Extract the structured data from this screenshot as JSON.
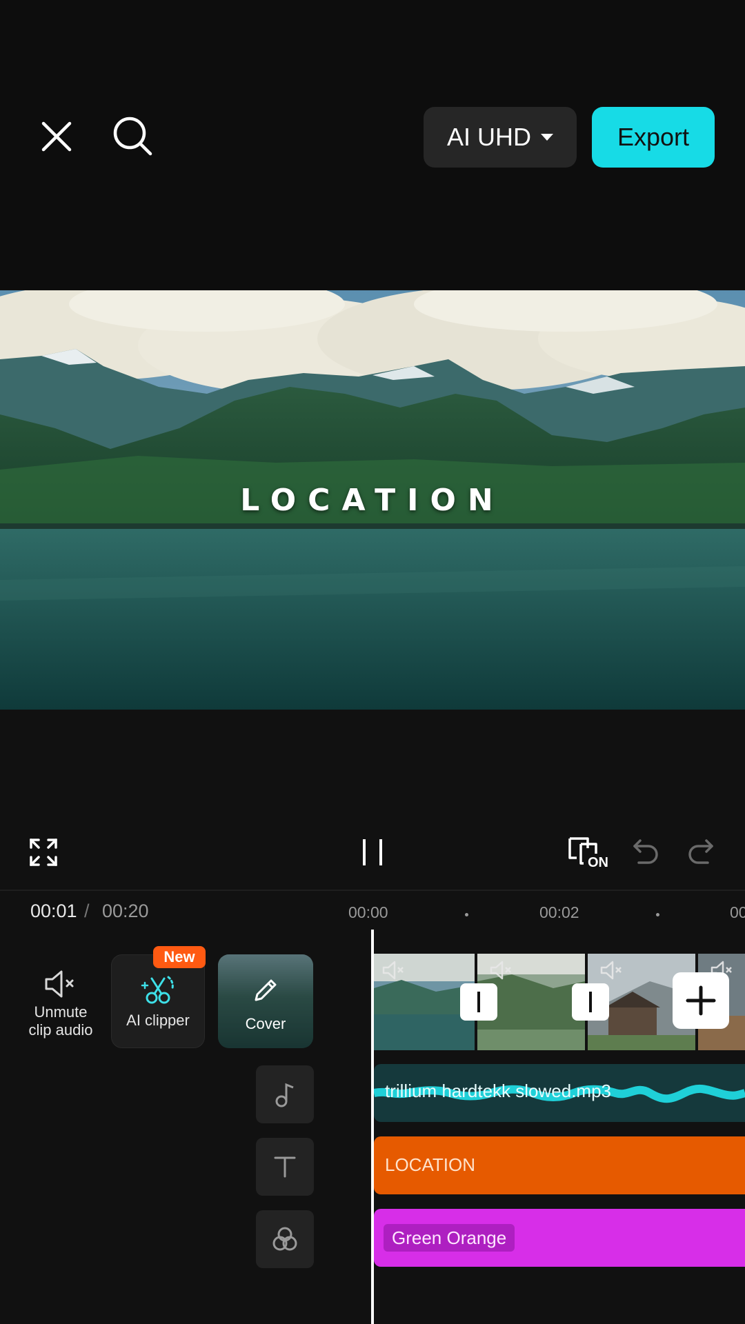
{
  "header": {
    "close_icon": "close-icon",
    "search_icon": "search-icon",
    "resolution_label": "AI UHD",
    "export_label": "Export",
    "accent_color": "#17dbe6"
  },
  "preview": {
    "overlay_text": "LOCATION"
  },
  "controls": {
    "fullscreen_icon": "fullscreen-icon",
    "pause_icon": "pause-icon",
    "main_track_icon": "main-track-toggle-icon",
    "main_track_badge": "ON",
    "undo_icon": "undo-icon",
    "redo_icon": "redo-icon"
  },
  "timeline": {
    "current_time": "00:01",
    "separator": "/",
    "total_time": "00:20",
    "ruler_labels": [
      "00:00",
      "00:02",
      "00"
    ]
  },
  "tools": {
    "unmute_label": "Unmute\nclip audio",
    "ai_clipper_label": "AI clipper",
    "new_badge": "New",
    "cover_label": "Cover"
  },
  "tracks": {
    "audio_name": "trillium hardtekk slowed.mp3",
    "audio_color": "#15393c",
    "text_name": "LOCATION",
    "text_color": "#e65a00",
    "filter_name": "Green Orange",
    "filter_color": "#d72ee8",
    "side_buttons": [
      "music-note-icon",
      "text-icon",
      "effects-icon"
    ]
  }
}
